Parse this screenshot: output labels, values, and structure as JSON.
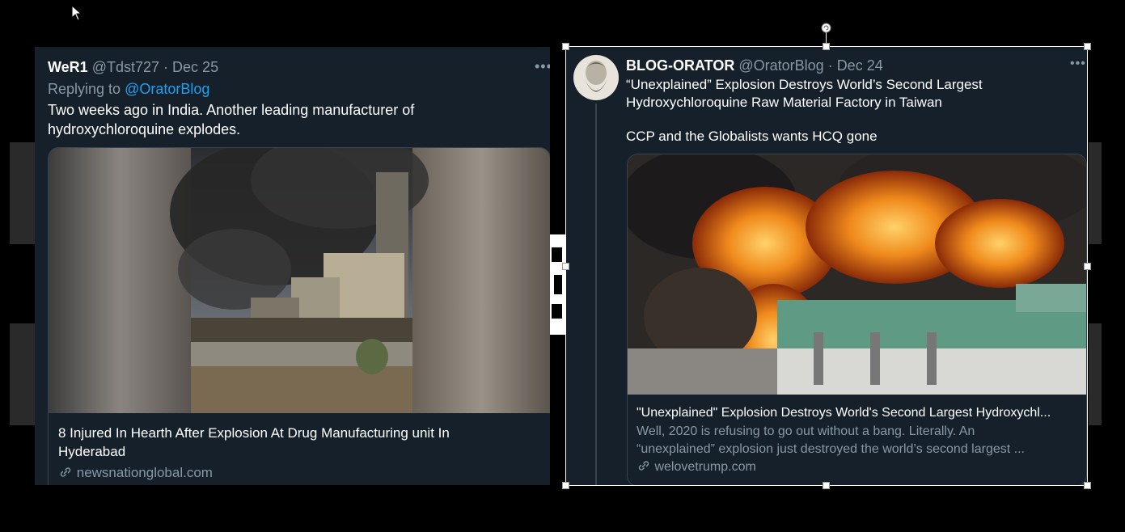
{
  "tweet_left": {
    "name": "WeR1",
    "handle": "@Tdst727",
    "dot": "·",
    "date": "Dec 25",
    "more": "•••",
    "replying_prefix": "Replying to ",
    "replying_to": "@OratorBlog",
    "text_line1": "Two weeks ago in India. Another leading manufacturer of",
    "text_line2": "hydroxychloroquine explodes.",
    "card": {
      "title_line1": "8 Injured In Hearth After Explosion At Drug Manufacturing unit In",
      "title_line2": "Hyderabad",
      "domain": "newsnationglobal.com",
      "link_icon": "link-icon"
    }
  },
  "tweet_right": {
    "name": "BLOG-ORATOR",
    "handle": "@OratorBlog",
    "dot": "·",
    "date": "Dec 24",
    "more": "•••",
    "text_line1": "“Unexplained” Explosion Destroys World’s Second Largest",
    "text_line2": "Hydroxychloroquine Raw Material Factory in Taiwan",
    "text_line3": "CCP and the Globalists wants HCQ gone",
    "card": {
      "title": "\"Unexplained\" Explosion Destroys World's Second Largest Hydroxychl...",
      "desc_line1": "Well, 2020 is refusing to go out without a bang. Literally. An",
      "desc_line2": "“unexplained” explosion just destroyed the world’s second largest ...",
      "domain": "welovetrump.com",
      "link_icon": "link-icon"
    }
  },
  "colors": {
    "tweet_bg": "#15202b",
    "secondary_text": "#8899a6",
    "link_blue": "#1da1f2",
    "border": "#38444d"
  }
}
